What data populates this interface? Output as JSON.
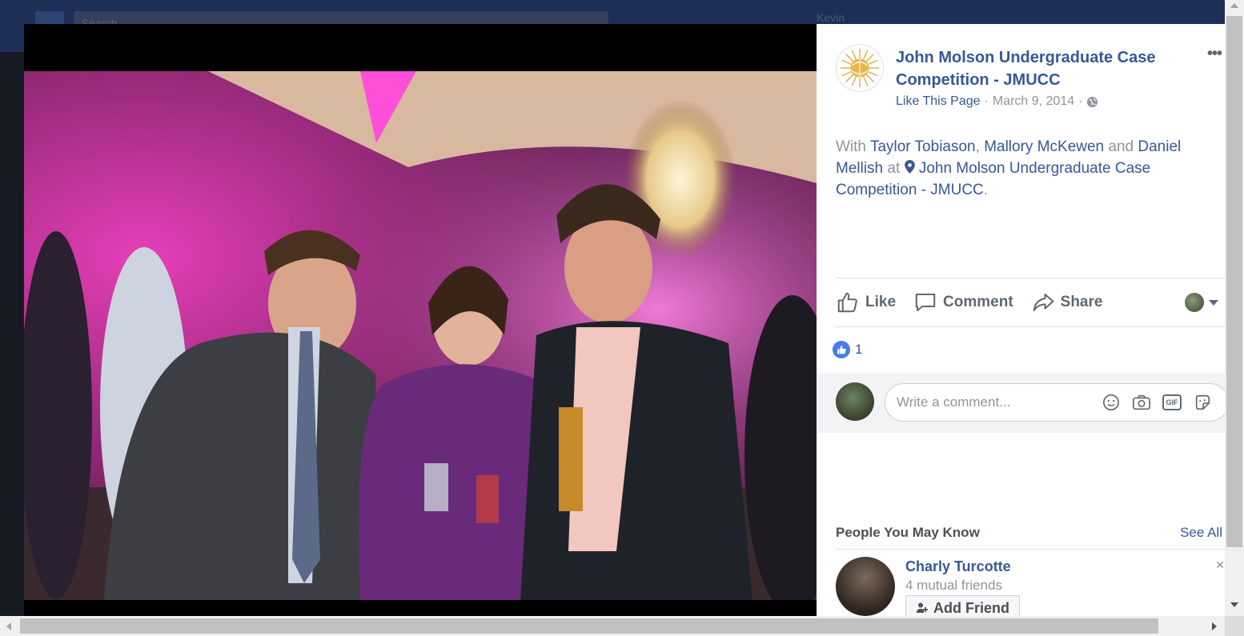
{
  "topbar": {
    "search_placeholder": "Search",
    "user_name": "Kevin"
  },
  "post": {
    "page_name": "John Molson Undergraduate Case Competition - JMUCC",
    "like_page": "Like This Page",
    "separator": "·",
    "date": "March 9, 2014",
    "with_label": "With",
    "tagged": [
      "Taylor Tobiason",
      "Mallory McKewen",
      "Daniel Mellish"
    ],
    "comma": ",",
    "and_label": "and",
    "at_label": "at",
    "location": "John Molson Undergraduate Case Competition - JMUCC",
    "period": "."
  },
  "actions": {
    "like": "Like",
    "comment": "Comment",
    "share": "Share"
  },
  "reactions": {
    "count": "1"
  },
  "comment": {
    "placeholder": "Write a comment..."
  },
  "pymk": {
    "title": "People You May Know",
    "see_all": "See All",
    "person": {
      "name": "Charly Turcotte",
      "mutual": "4 mutual friends",
      "add_friend": "Add Friend"
    }
  },
  "colors": {
    "link": "#365899",
    "muted": "#90949c",
    "like_blue": "#4a7be8",
    "stage": "#000000"
  }
}
